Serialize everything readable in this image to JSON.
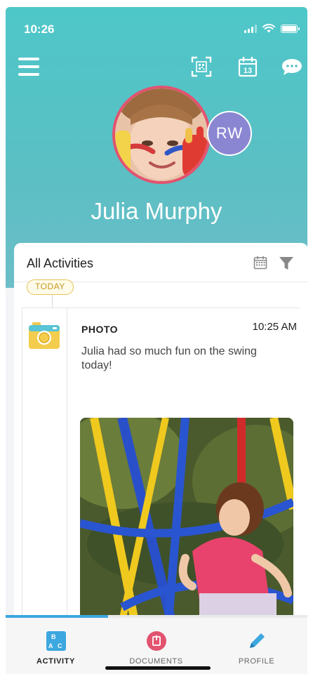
{
  "status_bar": {
    "time": "10:26"
  },
  "toolbar": {
    "menu_icon": "hamburger-menu-icon",
    "qr_icon": "qr-scan-icon",
    "calendar_day": "13",
    "chat_icon": "chat-bubble-icon"
  },
  "profile": {
    "name": "Julia Murphy",
    "secondary_avatar_initials": "RW",
    "secondary_avatar_color": "#8b86d2",
    "main_avatar_border_color": "#e2536f"
  },
  "activity_card": {
    "title": "All Activities",
    "date_label": "TODAY"
  },
  "feed": [
    {
      "type": "PHOTO",
      "time": "10:25 AM",
      "text": "Julia had so much fun on the swing today!",
      "icon": "camera-icon"
    }
  ],
  "progress": {
    "fraction": 0.34
  },
  "tabs": [
    {
      "label": "ACTIVITY",
      "icon": "abc-blocks-icon",
      "active": true
    },
    {
      "label": "DOCUMENTS",
      "icon": "document-icon",
      "active": false
    },
    {
      "label": "PROFILE",
      "icon": "pencil-icon",
      "active": false
    }
  ],
  "colors": {
    "hero_gradient_top": "#4ec7c9",
    "accent_blue": "#3da7df",
    "today_pill": "#e6c25a",
    "documents_red": "#e2536f"
  }
}
